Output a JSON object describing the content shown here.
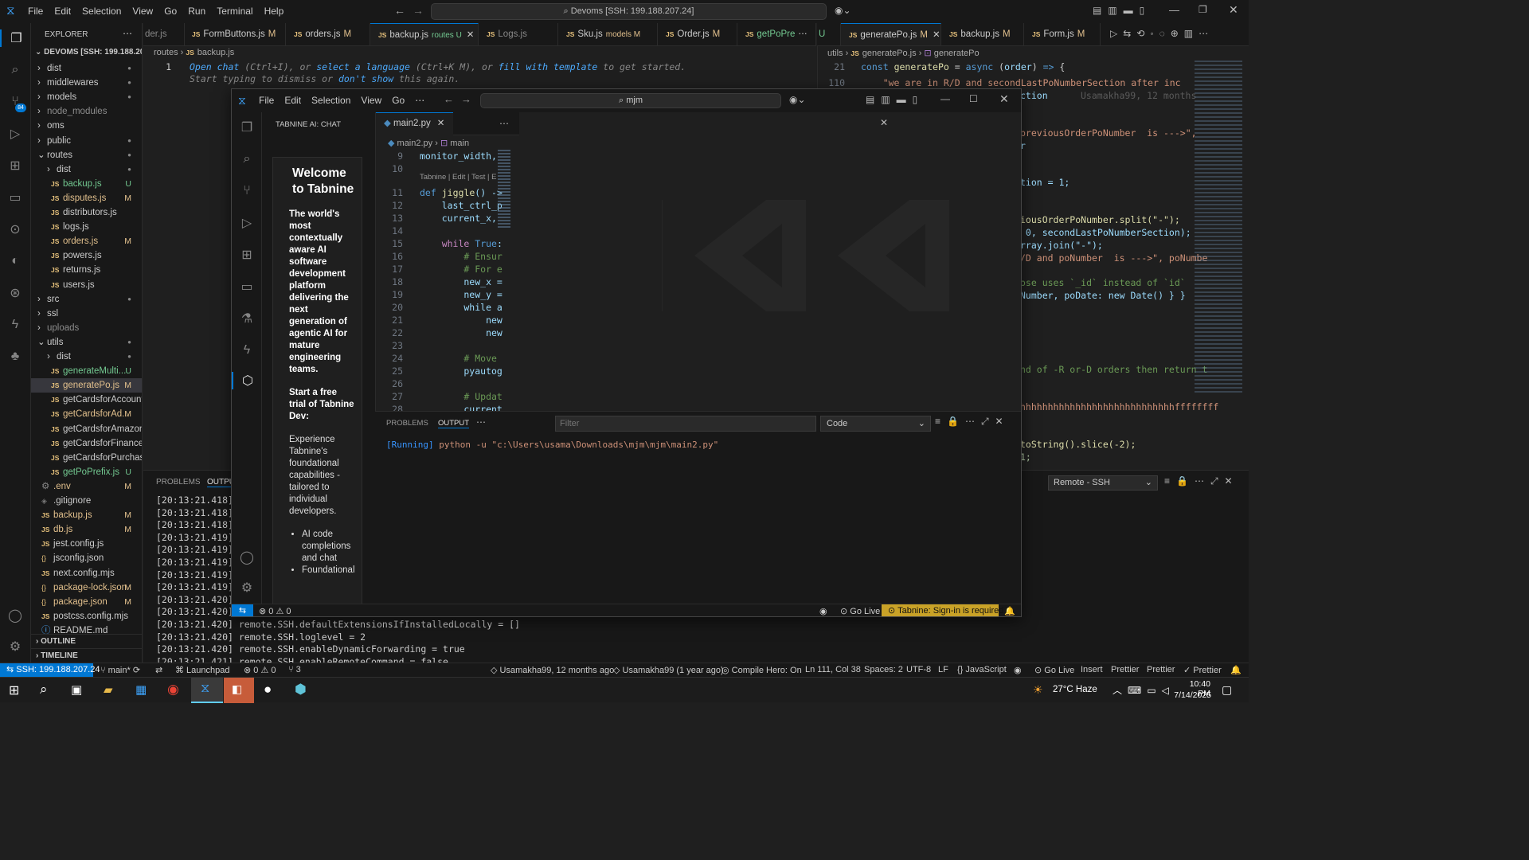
{
  "main": {
    "menu": [
      "File",
      "Edit",
      "Selection",
      "View",
      "Go",
      "Run",
      "Terminal",
      "Help"
    ],
    "command_center": "Devoms [SSH: 199.188.207.24]",
    "explorer": {
      "header": "EXPLORER",
      "root": "DEVOMS [SSH: 199.188.20...",
      "items": [
        {
          "label": "dist",
          "kind": "folder",
          "status": "●"
        },
        {
          "label": "middlewares",
          "kind": "folder",
          "status": "●"
        },
        {
          "label": "models",
          "kind": "folder",
          "status": "●"
        },
        {
          "label": "node_modules",
          "kind": "folder",
          "status": ""
        },
        {
          "label": "oms",
          "kind": "folder",
          "status": ""
        },
        {
          "label": "public",
          "kind": "folder",
          "status": "●"
        },
        {
          "label": "routes",
          "kind": "folder-open",
          "status": "●"
        },
        {
          "label": "dist",
          "kind": "folder",
          "status": "●"
        },
        {
          "label": "backup.js",
          "kind": "file",
          "status": "U"
        },
        {
          "label": "disputes.js",
          "kind": "file",
          "status": "M"
        },
        {
          "label": "distributors.js",
          "kind": "file",
          "status": ""
        },
        {
          "label": "logs.js",
          "kind": "file",
          "status": ""
        },
        {
          "label": "orders.js",
          "kind": "file",
          "status": "M"
        },
        {
          "label": "powers.js",
          "kind": "file",
          "status": ""
        },
        {
          "label": "returns.js",
          "kind": "file",
          "status": ""
        },
        {
          "label": "users.js",
          "kind": "file",
          "status": ""
        },
        {
          "label": "src",
          "kind": "folder",
          "status": "●"
        },
        {
          "label": "ssl",
          "kind": "folder",
          "status": ""
        },
        {
          "label": "uploads",
          "kind": "folder",
          "status": ""
        },
        {
          "label": "utils",
          "kind": "folder-open",
          "status": "●"
        },
        {
          "label": "dist",
          "kind": "folder",
          "status": "●"
        },
        {
          "label": "generateMulti...",
          "kind": "file",
          "status": "U"
        },
        {
          "label": "generatePo.js",
          "kind": "file",
          "status": "M"
        },
        {
          "label": "getCardsforAccount.js",
          "kind": "file",
          "status": ""
        },
        {
          "label": "getCardsforAd...",
          "kind": "file",
          "status": "M"
        },
        {
          "label": "getCardsforAmazon.js",
          "kind": "file",
          "status": ""
        },
        {
          "label": "getCardsforFinance.js",
          "kind": "file",
          "status": ""
        },
        {
          "label": "getCardsforPurchasi...",
          "kind": "file",
          "status": ""
        },
        {
          "label": "getPoPrefix.js",
          "kind": "file",
          "status": "U"
        },
        {
          "label": ".env",
          "kind": "gear",
          "status": "M"
        },
        {
          "label": ".gitignore",
          "kind": "dot",
          "status": ""
        },
        {
          "label": "backup.js",
          "kind": "file",
          "status": "M"
        },
        {
          "label": "db.js",
          "kind": "file",
          "status": "M"
        },
        {
          "label": "jest.config.js",
          "kind": "file",
          "status": ""
        },
        {
          "label": "jsconfig.json",
          "kind": "json",
          "status": ""
        },
        {
          "label": "next.config.mjs",
          "kind": "file",
          "status": ""
        },
        {
          "label": "package-lock.json",
          "kind": "json",
          "status": "M"
        },
        {
          "label": "package.json",
          "kind": "json",
          "status": "M"
        },
        {
          "label": "postcss.config.mjs",
          "kind": "file",
          "status": ""
        },
        {
          "label": "README.md",
          "kind": "info",
          "status": ""
        }
      ],
      "outline": "OUTLINE",
      "timeline": "TIMELINE"
    },
    "tabs": [
      {
        "label": "der.js",
        "badge": ""
      },
      {
        "label": "FormButtons.js",
        "badge": "M"
      },
      {
        "label": "orders.js",
        "badge": "M"
      },
      {
        "label": "backup.js",
        "badge": "routes U"
      },
      {
        "label": "Logs.js",
        "badge": ""
      },
      {
        "label": "Sku.js",
        "badge": "models M"
      },
      {
        "label": "Order.js",
        "badge": "M"
      },
      {
        "label": "getPoPre",
        "badge": ""
      }
    ],
    "tabs_right": [
      {
        "label": "U",
        "badge": ""
      },
      {
        "label": "generatePo.js",
        "badge": "M"
      },
      {
        "label": "backup.js",
        "badge": "M"
      },
      {
        "label": "Form.js",
        "badge": "M"
      }
    ],
    "breadcrumb_left": [
      "routes",
      "backup.js"
    ],
    "breadcrumb_right": [
      "utils",
      "generatePo.js",
      "generatePo"
    ],
    "left_editor": {
      "line_no": "1",
      "hint_parts": [
        "Open chat",
        " (Ctrl+I), or ",
        "select a language",
        " (Ctrl+K M), or ",
        "fill with template",
        " to get started."
      ],
      "hint2_parts": [
        "Start typing to dismiss or ",
        "don't show",
        " this again."
      ]
    },
    "right_editor": {
      "lines": [
        {
          "n": "21",
          "text": "const generatePo = async (order) => {"
        },
        {
          "n": "110",
          "text": "    \"we are in R/D and secondLastPoNumberSection after inc"
        },
        {
          "n": "",
          "text": "ction"
        },
        {
          "n": "",
          "text": "previousOrderPoNumber  is --->\","
        },
        {
          "n": "",
          "text": "r"
        },
        {
          "n": "",
          "text": "tion = 1;"
        },
        {
          "n": "",
          "text": "iousOrderPoNumber.split(\"-\");"
        },
        {
          "n": "",
          "text": " 0, secondLastPoNumberSection);"
        },
        {
          "n": "",
          "text": "rray.join(\"-\");"
        },
        {
          "n": "",
          "text": "/D and poNumber  is --->\", poNumbe"
        },
        {
          "n": "",
          "text": "ose uses `_id` instead of `id`"
        },
        {
          "n": "",
          "text": "Number, poDate: new Date() } }"
        },
        {
          "n": "",
          "text": "nd of -R or-D orders then return t"
        },
        {
          "n": "",
          "text": "hhhhhhhhhhhhhhhhhhhhhhhhhhhhffffffff"
        },
        {
          "n": "",
          "text": "toString().slice(-2);"
        },
        {
          "n": "",
          "text": "1;"
        },
        {
          "n": "",
          "text": "1;"
        }
      ],
      "blame": "Usamakha99, 12 months"
    },
    "bottom_panel": {
      "tabs": [
        "PROBLEMS",
        "OUTPUT"
      ],
      "dropdown": "Remote - SSH",
      "timestamps": [
        "[20:13:21.418]",
        "[20:13:21.418]",
        "[20:13:21.418]",
        "[20:13:21.419]",
        "[20:13:21.419]",
        "[20:13:21.419]",
        "[20:13:21.419]",
        "[20:13:21.419]",
        "[20:13:21.420]",
        "[20:13:21.420]"
      ],
      "lines": [
        {
          "ts": "[20:13:21.420]",
          "text": "remote.SSH.defaultExtensionsIfInstalledLocally = []"
        },
        {
          "ts": "[20:13:21.420]",
          "text": "remote.SSH.loglevel = 2"
        },
        {
          "ts": "[20:13:21.420]",
          "text": "remote.SSH.enableDynamicForwarding = true"
        },
        {
          "ts": "[20:13:21.421]",
          "text": "remote.SSH.enableRemoteCommand = false"
        }
      ]
    },
    "status": {
      "remote": "SSH: 199.188.207.24",
      "branch": "main*",
      "errors": "0",
      "warnings": "0",
      "ports": "3",
      "blame1": "Usamakha99, 12 months ago",
      "blame2": "Usamakha99 (1 year ago)",
      "compile": "Compile Hero: On",
      "position": "Ln 111, Col 38",
      "spaces": "Spaces: 2",
      "encoding": "UTF-8",
      "eol": "LF",
      "language": "JavaScript",
      "golive": "Go Live",
      "insert": "Insert",
      "prettier1": "Prettier",
      "prettier2": "Prettier",
      "prettier3": "Prettier"
    }
  },
  "overlay": {
    "menu": [
      "File",
      "Edit",
      "Selection",
      "View",
      "Go"
    ],
    "search": "mjm",
    "chat": {
      "header": "TABNINE AI: CHAT",
      "welcome": "Welcome to Tabnine",
      "intro": "The world's most contextually aware AI software development platform delivering the next generation of agentic AI for mature engineering teams.",
      "trial_title": "Start a free trial of Tabnine Dev:",
      "trial_body": "Experience Tabnine's foundational capabilities - tailored to individual developers.",
      "bullets": [
        "AI code completions and chat",
        "Foundational"
      ]
    },
    "editor_tab": "main2.py",
    "breadcrumb": [
      "main2.py",
      "main"
    ],
    "codelens": "Tabnine | Edit | Test | E",
    "code": [
      {
        "n": "9",
        "text": "monitor_width,"
      },
      {
        "n": "10",
        "text": ""
      },
      {
        "n": "11",
        "text": "def jiggle() ->"
      },
      {
        "n": "12",
        "text": "    last_ctrl_p"
      },
      {
        "n": "13",
        "text": "    current_x,"
      },
      {
        "n": "14",
        "text": ""
      },
      {
        "n": "15",
        "text": "    while True:"
      },
      {
        "n": "16",
        "text": "        # Ensur"
      },
      {
        "n": "17",
        "text": "        # For e"
      },
      {
        "n": "18",
        "text": "        new_x ="
      },
      {
        "n": "19",
        "text": "        new_y ="
      },
      {
        "n": "20",
        "text": "        while a"
      },
      {
        "n": "21",
        "text": "            new"
      },
      {
        "n": "22",
        "text": "            new"
      },
      {
        "n": "23",
        "text": ""
      },
      {
        "n": "24",
        "text": "        # Move"
      },
      {
        "n": "25",
        "text": "        pyautog"
      },
      {
        "n": "26",
        "text": ""
      },
      {
        "n": "27",
        "text": "        # Updat"
      },
      {
        "n": "28",
        "text": "        current"
      }
    ],
    "panel": {
      "tabs": [
        "PROBLEMS",
        "OUTPUT"
      ],
      "filter_placeholder": "Filter",
      "dropdown": "Code",
      "running": "[Running]",
      "command": " python -u \"c:\\Users\\usama\\Downloads\\mjm\\mjm\\main2.py\""
    },
    "status": {
      "errors": "0",
      "warnings": "0",
      "golive": "Go Live",
      "tabnine": "Tabnine: Sign-in is required"
    }
  },
  "taskbar": {
    "weather": "27°C  Haze",
    "time": "10:40 PM",
    "date": "7/14/2025"
  },
  "colors": {
    "accent": "#0078d4",
    "modified": "#e2c08d",
    "untracked": "#73c991",
    "tabnine": "#c9a227"
  }
}
